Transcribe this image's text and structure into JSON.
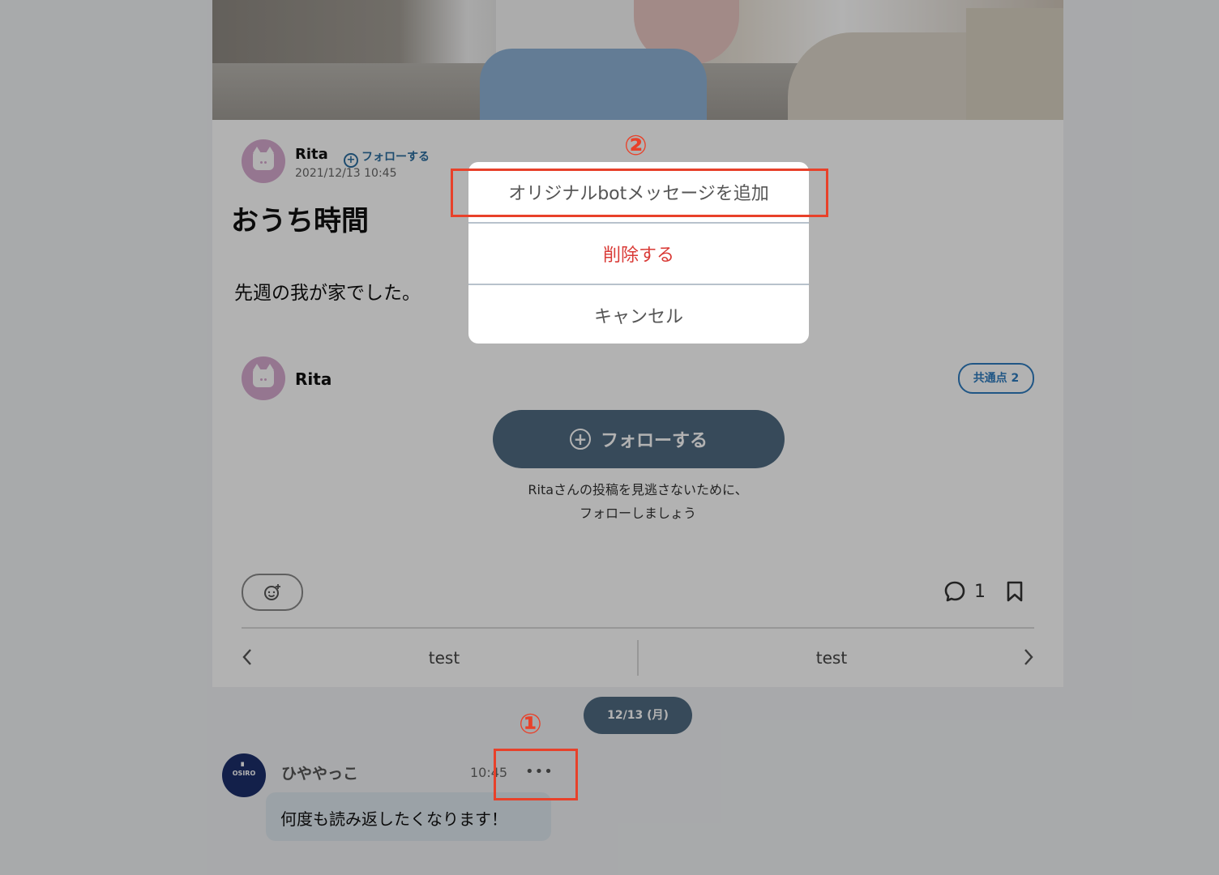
{
  "post": {
    "author_name": "Rita",
    "follow_link_label": "フォローする",
    "date": "2021/12/13 10:45",
    "title": "おうち時間",
    "body": "先週の我が家でした。"
  },
  "author_card": {
    "name": "Rita",
    "common_badge": "共通点 2",
    "follow_button_label": "フォローする",
    "hint_line1": "Ritaさんの投稿を見逃さないために、",
    "hint_line2": "フォローしましょう"
  },
  "actions": {
    "comment_count": "1"
  },
  "pager": {
    "prev_label": "test",
    "next_label": "test"
  },
  "chat": {
    "date_pill": "12/13 (月)",
    "avatar_text": "OSIRO",
    "sender": "ひややっこ",
    "time": "10:45",
    "more": "•••",
    "message": "何度も読み返したくなります！"
  },
  "action_sheet": {
    "items": [
      {
        "label": "オリジナルbotメッセージを追加"
      },
      {
        "label": "削除する"
      },
      {
        "label": "キャンセル"
      }
    ]
  },
  "annotations": {
    "step1": "①",
    "step2": "②",
    "color": "#e8412a"
  }
}
